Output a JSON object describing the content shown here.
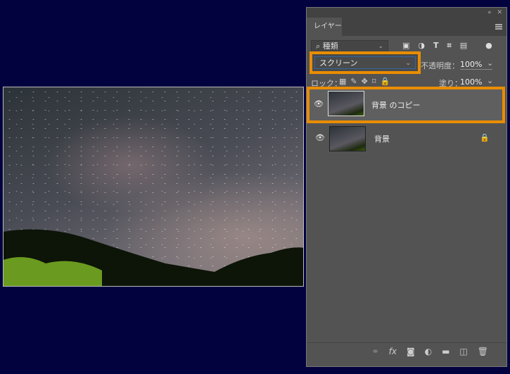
{
  "panel": {
    "tab": "レイヤー",
    "filter": "種類",
    "blend_mode": "スクリーン",
    "opacity_label": "不透明度：",
    "opacity": "100%",
    "lock_label": "ロック：",
    "fill_label": "塗り：",
    "fill": "100%"
  },
  "layers": [
    {
      "name": "背景 のコピー",
      "visible": true,
      "selected": true
    },
    {
      "name": "背景",
      "visible": true,
      "locked": true
    }
  ],
  "bottom_icons": [
    "link-icon",
    "fx-icon",
    "mask-icon",
    "adjustment-icon",
    "folder-icon",
    "new-layer-icon",
    "trash-icon"
  ],
  "bottom_labels": {
    "fx": "fx"
  },
  "colors": {
    "highlight": "#e98d00",
    "background": "#02023f"
  }
}
